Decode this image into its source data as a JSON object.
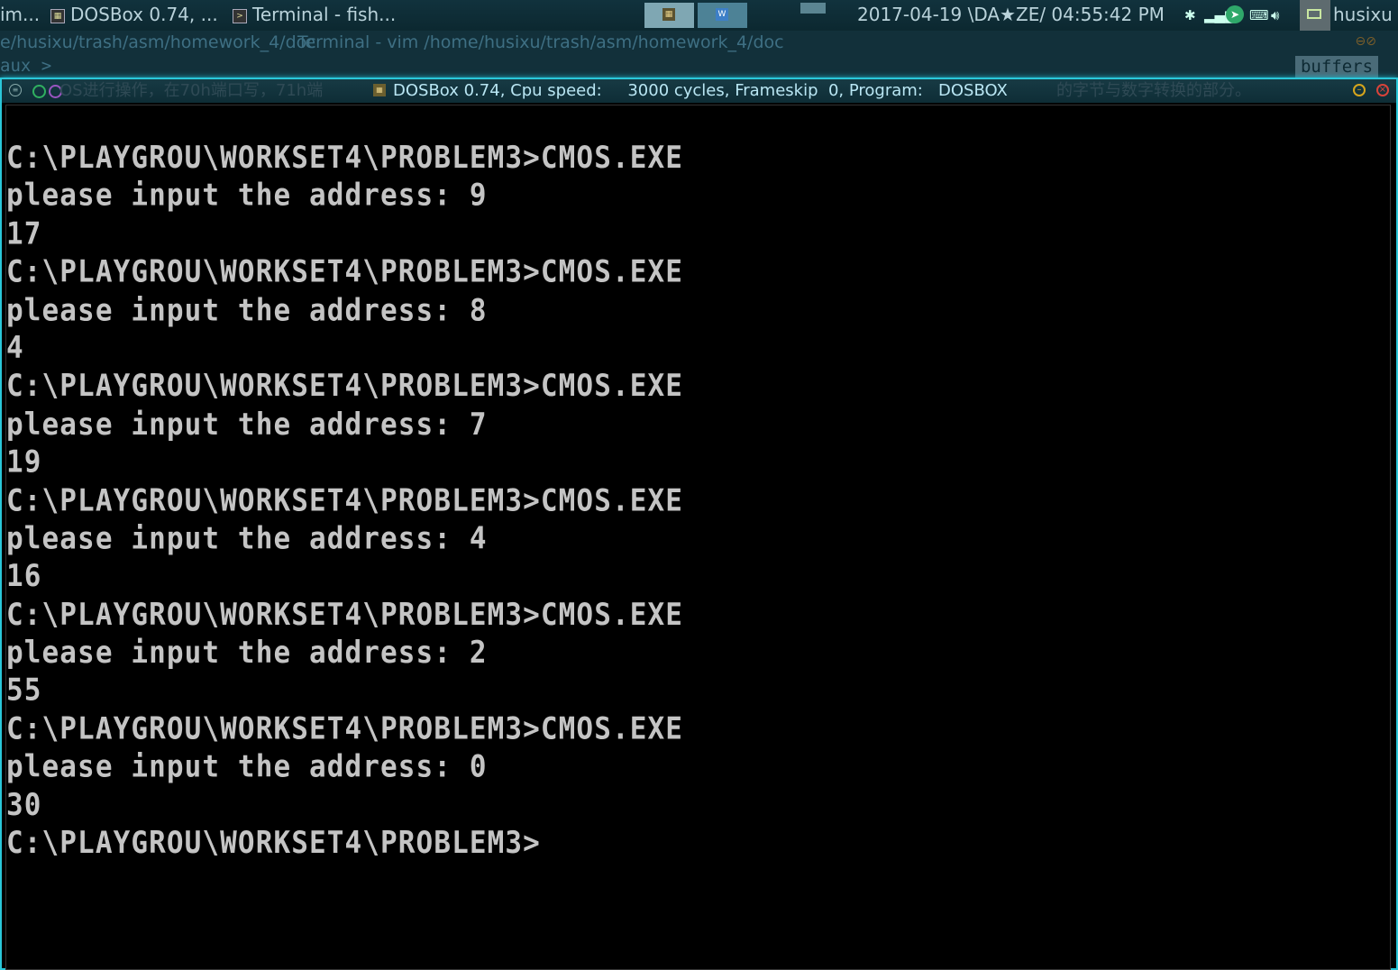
{
  "taskbar": {
    "tasks": [
      {
        "label": "im...",
        "icon": "emacs-icon"
      },
      {
        "label": "DOSBox 0.74, ...",
        "icon": "dosbox-icon"
      },
      {
        "label": "Terminal - fish...",
        "icon": "terminal-icon"
      }
    ],
    "pager": {
      "desk1_icon": "DOS BOX",
      "desk2_icon": "W"
    },
    "clock": "2017-04-19 \\DA★ZE/ 04:55:42 PM",
    "username": "husixu",
    "colors": {
      "panel": "#11323d",
      "accent": "#2ac7d9",
      "telegram": "#2fa86a"
    }
  },
  "background_window": {
    "path": "e/husixu/trash/asm/homework_4/doc",
    "path_overlap": "Terminal - vim  /home/husixu/trash/asm/homework_4/doc",
    "mode": "aux >",
    "buffers_label": "buffers"
  },
  "dosbox": {
    "title": "DOSBox 0.74, Cpu speed:     3000 cycles, Frameskip  0, Program:   DOSBOX",
    "title_icon": "DOS BOX",
    "ghost_left": "OS进行操作，在70h端口写，71h端",
    "ghost_right": "的字节与数字转换的部分。",
    "console_lines": [
      "C:\\PLAYGROU\\WORKSET4\\PROBLEM3>CMOS.EXE",
      "please input the address: 9",
      "17",
      "C:\\PLAYGROU\\WORKSET4\\PROBLEM3>CMOS.EXE",
      "please input the address: 8",
      "4",
      "C:\\PLAYGROU\\WORKSET4\\PROBLEM3>CMOS.EXE",
      "please input the address: 7",
      "19",
      "C:\\PLAYGROU\\WORKSET4\\PROBLEM3>CMOS.EXE",
      "please input the address: 4",
      "16",
      "C:\\PLAYGROU\\WORKSET4\\PROBLEM3>CMOS.EXE",
      "please input the address: 2",
      "55",
      "C:\\PLAYGROU\\WORKSET4\\PROBLEM3>CMOS.EXE",
      "please input the address: 0",
      "30",
      "C:\\PLAYGROU\\WORKSET4\\PROBLEM3>"
    ]
  }
}
